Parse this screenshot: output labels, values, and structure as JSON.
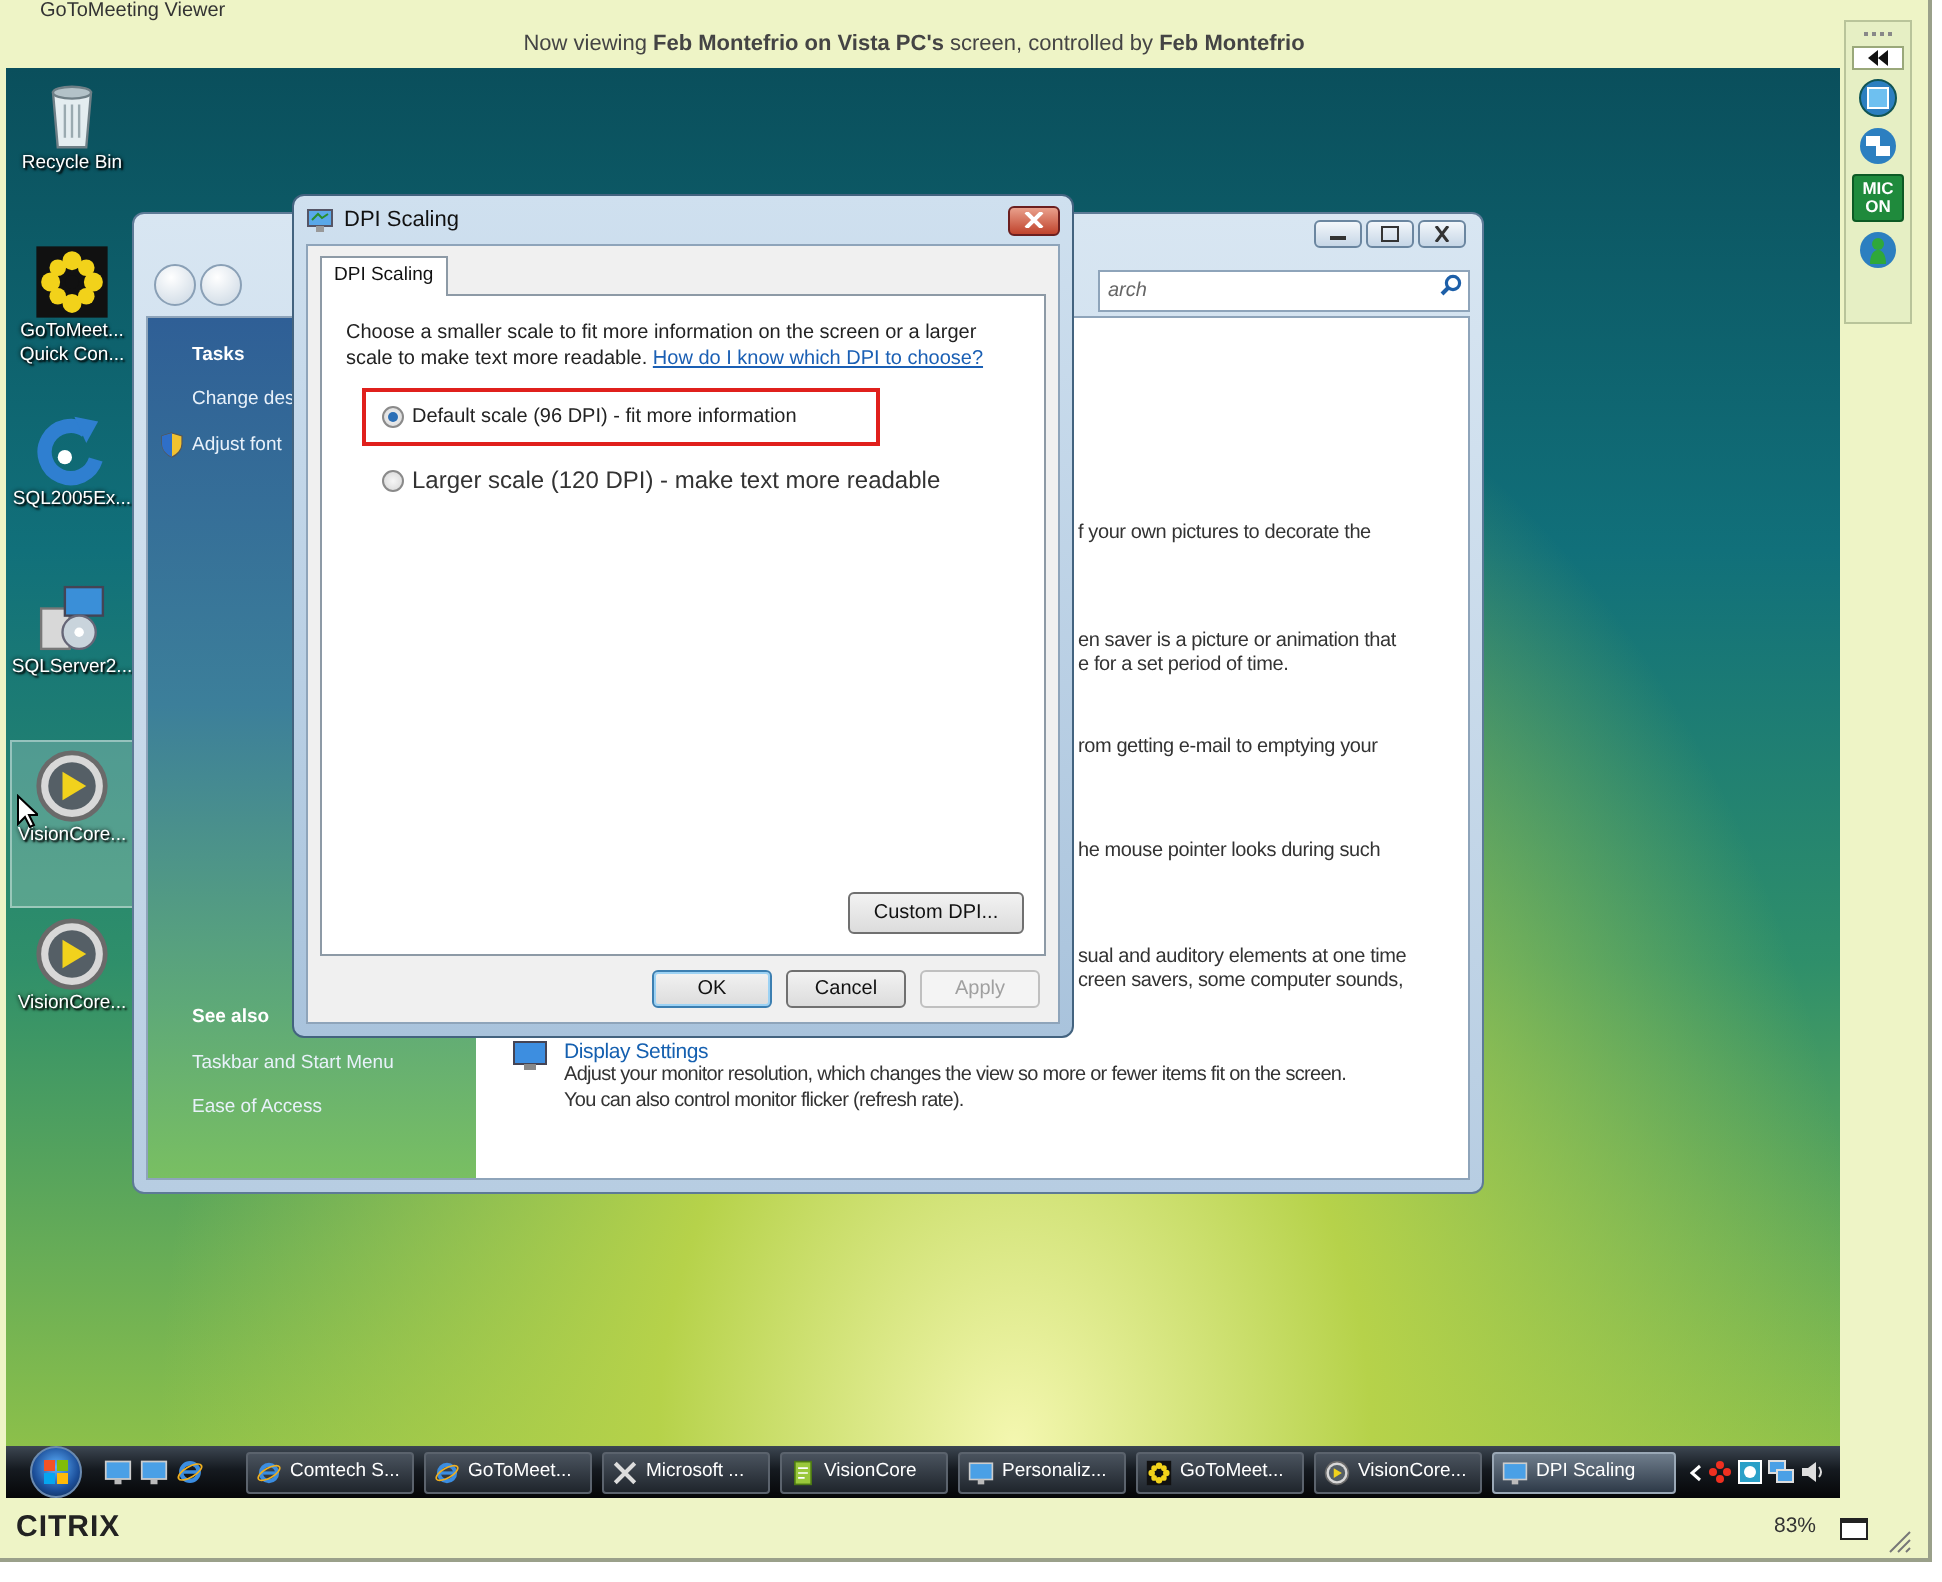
{
  "viewer": {
    "title": "GoToMeeting Viewer",
    "banner": "Now viewing **Feb Montefrio on Vista PC's** screen, controlled by **Feb Montefrio**"
  },
  "side_panel": {
    "mic_button": "MIC ON"
  },
  "desktop_icons": [
    {
      "label_lines": [
        "Recycle Bin"
      ],
      "kind": "recycle",
      "selected": false
    },
    {
      "label_lines": [
        "GoToMeet...",
        "Quick Con..."
      ],
      "kind": "gotomeeting",
      "selected": false
    },
    {
      "label_lines": [
        "SQL2005Ex..."
      ],
      "kind": "arrow",
      "selected": false
    },
    {
      "label_lines": [
        "SQLServer2..."
      ],
      "kind": "installer",
      "selected": false
    },
    {
      "label_lines": [
        "VisionCore..."
      ],
      "kind": "disc",
      "selected": true
    },
    {
      "label_lines": [
        "VisionCore..."
      ],
      "kind": "disc",
      "selected": false
    }
  ],
  "control_panel": {
    "search_placeholder": "arch",
    "tasks": {
      "heading": "Tasks",
      "items": [
        {
          "label": "Change des",
          "kind": "link"
        },
        {
          "label": "Adjust font",
          "kind": "shield"
        }
      ]
    },
    "see_also": {
      "heading": "See also",
      "items": [
        "Taskbar and Start Menu",
        "Ease of Access"
      ]
    },
    "fragments": [
      [
        "f your own pictures to decorate the"
      ],
      [
        "en saver is a picture or animation that",
        "e for a set period of time."
      ],
      [
        "rom getting e-mail to emptying your"
      ],
      [
        "he mouse pointer looks during such"
      ],
      [
        "sual and auditory elements at one time",
        "creen savers, some computer sounds,"
      ]
    ],
    "display_settings": {
      "title": "Display Settings",
      "description_lines": [
        "Adjust your monitor resolution, which changes the view so more or fewer items fit on the screen.",
        "You can also control monitor flicker (refresh rate)."
      ]
    }
  },
  "dialog": {
    "title": "DPI Scaling",
    "tabs": [
      {
        "label": "DPI Scaling",
        "selected": true
      }
    ],
    "intro": "Choose a smaller scale to fit more information on the screen or a larger scale to make text more readable.",
    "help_link": "How do I know which DPI to choose?",
    "options": [
      {
        "label": "Default scale (96 DPI) - fit more information",
        "kind": "normal",
        "selected": true,
        "highlighted": true
      },
      {
        "label": "Larger scale (120 DPI) - make text more readable",
        "kind": "large",
        "selected": false,
        "highlighted": false
      }
    ],
    "custom_button": "Custom DPI...",
    "buttons": [
      {
        "label": "OK",
        "default": true,
        "disabled": false
      },
      {
        "label": "Cancel",
        "default": false,
        "disabled": false
      },
      {
        "label": "Apply",
        "default": false,
        "disabled": true
      }
    ]
  },
  "taskbar": {
    "buttons": [
      {
        "label": "Comtech S...",
        "kind": "ie",
        "selected": false
      },
      {
        "label": "GoToMeet...",
        "kind": "ie",
        "selected": false
      },
      {
        "label": "Microsoft ...",
        "kind": "tools",
        "selected": false
      },
      {
        "label": "VisionCore",
        "kind": "document",
        "selected": false
      },
      {
        "label": "Personaliz...",
        "kind": "monitor",
        "selected": false
      },
      {
        "label": "GoToMeet...",
        "kind": "gotomeeting",
        "selected": false
      },
      {
        "label": "VisionCore...",
        "kind": "disc",
        "selected": false
      },
      {
        "label": "DPI Scaling",
        "kind": "monitor",
        "selected": true
      }
    ]
  },
  "status_bar": {
    "logo": "CITRIX",
    "zoom": "83%"
  }
}
